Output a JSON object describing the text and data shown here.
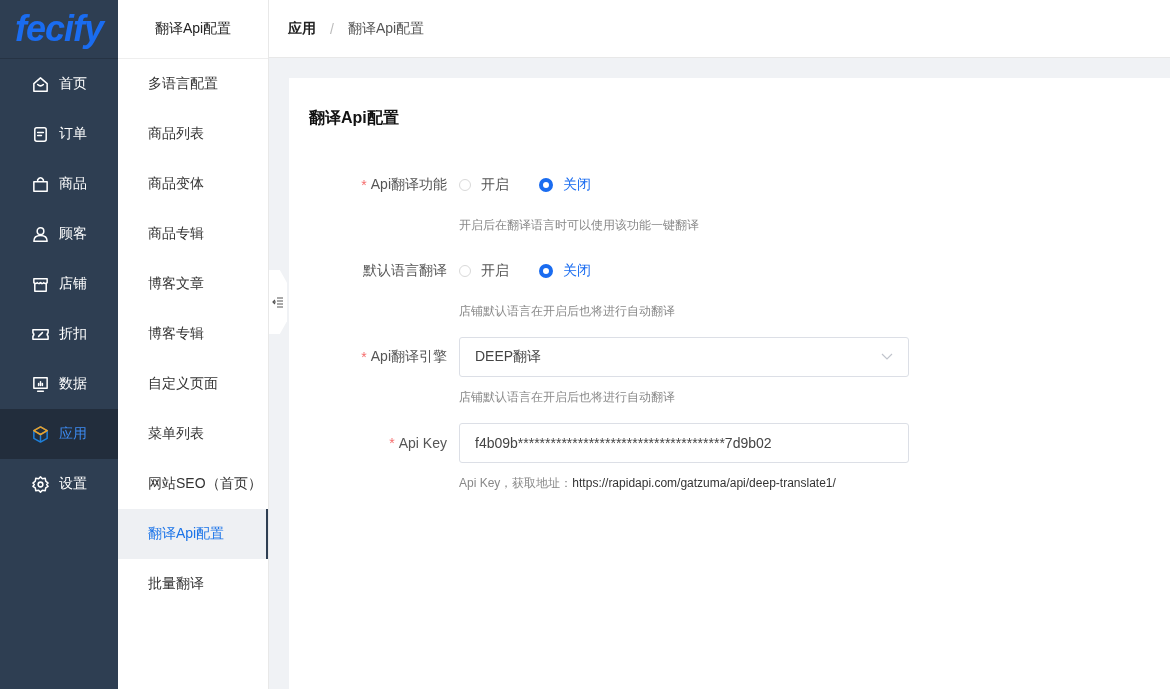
{
  "logo": {
    "text": "fecify"
  },
  "nav": [
    {
      "label": "首页",
      "selected": false
    },
    {
      "label": "订单",
      "selected": false
    },
    {
      "label": "商品",
      "selected": false
    },
    {
      "label": "顾客",
      "selected": false
    },
    {
      "label": "店铺",
      "selected": false
    },
    {
      "label": "折扣",
      "selected": false
    },
    {
      "label": "数据",
      "selected": false
    },
    {
      "label": "应用",
      "selected": true
    },
    {
      "label": "设置",
      "selected": false
    }
  ],
  "submenu": {
    "title": "翻译Api配置",
    "items": [
      {
        "label": "多语言配置",
        "selected": false
      },
      {
        "label": "商品列表",
        "selected": false
      },
      {
        "label": "商品变体",
        "selected": false
      },
      {
        "label": "商品专辑",
        "selected": false
      },
      {
        "label": "博客文章",
        "selected": false
      },
      {
        "label": "博客专辑",
        "selected": false
      },
      {
        "label": "自定义页面",
        "selected": false
      },
      {
        "label": "菜单列表",
        "selected": false
      },
      {
        "label": "网站SEO（首页）",
        "selected": false
      },
      {
        "label": "翻译Api配置",
        "selected": true
      },
      {
        "label": "批量翻译",
        "selected": false
      }
    ]
  },
  "breadcrumb": {
    "separator": "/",
    "items": [
      "应用",
      "翻译Api配置"
    ]
  },
  "card": {
    "title": "翻译Api配置",
    "fields": [
      {
        "kind": "radio",
        "label": "Api翻译功能",
        "required_mark": "*",
        "options": [
          {
            "label": "开启",
            "selected": false
          },
          {
            "label": "关闭",
            "selected": true
          }
        ],
        "hint": "开启后在翻译语言时可以使用该功能一键翻译"
      },
      {
        "kind": "radio",
        "label": "默认语言翻译",
        "options": [
          {
            "label": "开启",
            "selected": false
          },
          {
            "label": "关闭",
            "selected": true
          }
        ],
        "hint": "店铺默认语言在开启后也将进行自动翻译"
      },
      {
        "kind": "select",
        "label": "Api翻译引擎",
        "required_mark": "*",
        "value": "DEEP翻译",
        "hint": "店铺默认语言在开启后也将进行自动翻译"
      },
      {
        "kind": "text",
        "label": "Api Key",
        "required_mark": "*",
        "value": "f4b09b**************************************7d9b02",
        "hint": "Api Key，获取地址：",
        "hint_link": "https://rapidapi.com/gatzuma/api/deep-translate1/"
      }
    ]
  }
}
